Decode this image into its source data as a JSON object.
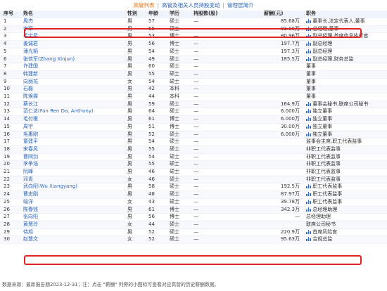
{
  "tabs": {
    "active": "高管列表",
    "sep1": "|",
    "holding": "高管及相关人员持股变动",
    "sep2": "|",
    "management": "管理层简介"
  },
  "table": {
    "headers": [
      "序号",
      "姓名",
      "性别",
      "年龄",
      "学历",
      "持股数(股)",
      "薪酬(元)",
      "职务"
    ],
    "rows": [
      [
        "1",
        "周杰",
        "男",
        "57",
        "硕士",
        "—",
        "85.68万",
        "董事长,法定代表人,董事",
        true
      ],
      [
        "2",
        "李军",
        "男",
        "55",
        "硕士",
        "—",
        "92.00万",
        "总经理,董事",
        true
      ],
      [
        "3",
        "毛宇星",
        "男",
        "53",
        "博士",
        "—",
        "80.96万",
        "副总经理,首席信息执行官",
        true
      ],
      [
        "4",
        "姜诚君",
        "男",
        "56",
        "博士",
        "—",
        "197.7万",
        "副总经理",
        true
      ],
      [
        "5",
        "潘光韬",
        "男",
        "54",
        "硕士",
        "—",
        "197.3万",
        "副总经理",
        true
      ],
      [
        "6",
        "张信军(Zhang Xinjun)",
        "男",
        "49",
        "硕士",
        "—",
        "185.5万",
        "副总经理,财务总监",
        true
      ],
      [
        "7",
        "许建国",
        "男",
        "60",
        "硕士",
        "—",
        "",
        "董事",
        false
      ],
      [
        "8",
        "韩建新",
        "男",
        "55",
        "硕士",
        "—",
        "",
        "董事",
        false
      ],
      [
        "9",
        "向丽花",
        "女",
        "54",
        "硕士",
        "—",
        "",
        "董事",
        false
      ],
      [
        "10",
        "石磊",
        "男",
        "42",
        "本科",
        "—",
        "",
        "董事",
        false
      ],
      [
        "11",
        "陈焕霖",
        "男",
        "44",
        "本科",
        "—",
        "",
        "董事",
        false
      ],
      [
        "12",
        "蔡长江",
        "男",
        "59",
        "硕士",
        "—",
        "164.9万",
        "董事会秘书,联席公司秘书",
        true
      ],
      [
        "13",
        "范仁达(Fan Ren Da, Anthony)",
        "男",
        "64",
        "硕士",
        "—",
        "6.000万",
        "独立董事",
        true
      ],
      [
        "14",
        "毛付根",
        "男",
        "61",
        "博士",
        "—",
        "6.000万",
        "独立董事",
        true
      ],
      [
        "15",
        "周宇",
        "男",
        "51",
        "博士",
        "—",
        "30.00万",
        "独立董事",
        true
      ],
      [
        "16",
        "毛惠刚",
        "男",
        "52",
        "硕士",
        "—",
        "6.000万",
        "独立董事",
        true
      ],
      [
        "17",
        "童建平",
        "男",
        "54",
        "硕士",
        "—",
        "",
        "监事会主席,职工代表监事",
        false
      ],
      [
        "18",
        "宋春风",
        "男",
        "55",
        "硕士",
        "—",
        "",
        "非职工代表监事",
        false
      ],
      [
        "19",
        "曹同剑",
        "男",
        "54",
        "硕士",
        "—",
        "",
        "非职工代表监事",
        false
      ],
      [
        "20",
        "李争浩",
        "男",
        "55",
        "硕士",
        "—",
        "",
        "非职工代表监事",
        false
      ],
      [
        "21",
        "阮峰",
        "男",
        "46",
        "硕士",
        "—",
        "",
        "非职工代表监事",
        false
      ],
      [
        "22",
        "邓青",
        "女",
        "46",
        "硕士",
        "—",
        "",
        "非职工代表监事",
        false
      ],
      [
        "23",
        "武向阳(Wu Xiangyang)",
        "男",
        "58",
        "硕士",
        "—",
        "192.5万",
        "职工代表监事",
        true
      ],
      [
        "24",
        "曹志刚",
        "男",
        "48",
        "硕士",
        "—",
        "87.97万",
        "职工代表监事",
        true
      ],
      [
        "25",
        "喻洋",
        "女",
        "43",
        "硕士",
        "—",
        "39.78万",
        "职工代表监事",
        true
      ],
      [
        "26",
        "陈春钱",
        "男",
        "61",
        "博士",
        "—",
        "342.3万",
        "总经理助理",
        true
      ],
      [
        "27",
        "张向阳",
        "男",
        "56",
        "博士",
        "—",
        "—",
        "总经理助理",
        false
      ],
      [
        "28",
        "黄慧玲",
        "女",
        "44",
        "硕士",
        "—",
        "",
        "联席公司秘书",
        false
      ],
      [
        "29",
        "侍旭",
        "男",
        "52",
        "硕士",
        "—",
        "220.9万",
        "首席风险官",
        true
      ],
      [
        "30",
        "赵慧文",
        "女",
        "52",
        "硕士",
        "—",
        "95.63万",
        "合规总监",
        true
      ]
    ]
  },
  "footer": "数据来源：最新报告期2023-12-31；注：点击 \"薪酬\" 列旁的小图标可查看对应高管的历史薪酬数据。",
  "colors": {
    "highlight": "#e02424",
    "link": "#2a63b7",
    "active_tab": "#e8720c",
    "header_bg": "#eff3fa"
  }
}
